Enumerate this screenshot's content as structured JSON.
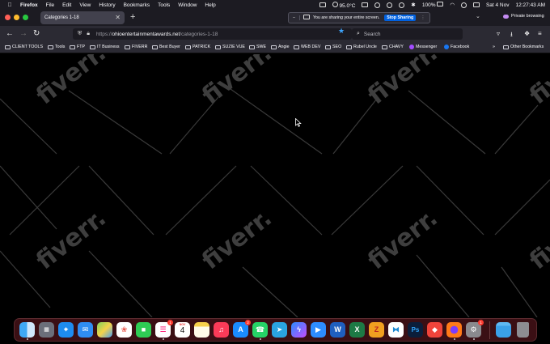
{
  "menubar": {
    "app": "Firefox",
    "items": [
      "File",
      "Edit",
      "View",
      "History",
      "Bookmarks",
      "Tools",
      "Window",
      "Help"
    ],
    "temperature": "95.0°C",
    "battery": "100%",
    "date": "Sat 4 Nov",
    "time": "12:27:43 AM"
  },
  "tabbar": {
    "tab_title": "Categories 1-18",
    "sharing_text": "You are sharing your entire screen.",
    "stop_sharing_label": "Stop Sharing",
    "private_label": "Private browsing"
  },
  "navbar": {
    "url_proto": "https://",
    "url_host": "ohioentertainmentawards.net",
    "url_path": "/categories-1-18",
    "search_placeholder": "Search"
  },
  "bookmarks": [
    {
      "label": "CLIENT TOOLS",
      "icon": "folder"
    },
    {
      "label": "Tools",
      "icon": "folder"
    },
    {
      "label": "FTP",
      "icon": "folder"
    },
    {
      "label": "IT Business",
      "icon": "folder"
    },
    {
      "label": "FIVERR",
      "icon": "folder"
    },
    {
      "label": "Best Buyer",
      "icon": "folder"
    },
    {
      "label": "PATRICK",
      "icon": "folder"
    },
    {
      "label": "SUZIE VUE",
      "icon": "folder"
    },
    {
      "label": "SWE",
      "icon": "folder"
    },
    {
      "label": "Angie",
      "icon": "folder"
    },
    {
      "label": "WEB DEV",
      "icon": "folder"
    },
    {
      "label": "SEO",
      "icon": "folder"
    },
    {
      "label": "Rubel Uncle",
      "icon": "folder"
    },
    {
      "label": "CHAVY",
      "icon": "folder"
    },
    {
      "label": "Messenger",
      "icon": "messenger"
    },
    {
      "label": "Facebook",
      "icon": "facebook"
    }
  ],
  "other_bookmarks": "Other Bookmarks",
  "watermark": "fiverr.",
  "dock": {
    "badges": {
      "reminders": "1",
      "appstore": "2",
      "settings": "1"
    },
    "calendar": {
      "month": "NOV",
      "day": "4"
    },
    "icons": [
      "finder",
      "launchpad",
      "safari",
      "mail",
      "maps",
      "photos",
      "facetime",
      "reminders",
      "calendar",
      "notes",
      "music",
      "app-store",
      "whatsapp",
      "telegram",
      "messenger",
      "zoom",
      "word",
      "excel",
      "filezilla",
      "vscode",
      "photoshop",
      "anydesk",
      "firefox",
      "system-settings",
      "downloads-folder",
      "trash"
    ]
  }
}
